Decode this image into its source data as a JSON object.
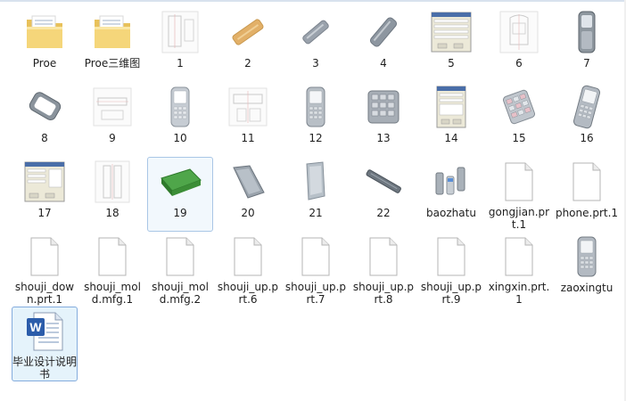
{
  "window": {
    "accent": "#84acdd",
    "selected_bg": "#e5f3fb"
  },
  "items": [
    {
      "label": "Proe",
      "icon": "folder-icon"
    },
    {
      "label": "Proe三维图",
      "icon": "folder-icon"
    },
    {
      "label": "1",
      "icon": "drawing-thumbnail-icon"
    },
    {
      "label": "2",
      "icon": "orange-bar-thumbnail-icon"
    },
    {
      "label": "3",
      "icon": "gray-bar-thumbnail-icon"
    },
    {
      "label": "4",
      "icon": "gray-bar-thumbnail-icon"
    },
    {
      "label": "5",
      "icon": "dialog-thumbnail-icon"
    },
    {
      "label": "6",
      "icon": "drawing-thumbnail-icon"
    },
    {
      "label": "7",
      "icon": "phone-shell-thumbnail-icon"
    },
    {
      "label": "8",
      "icon": "phone-frame-thumbnail-icon"
    },
    {
      "label": "9",
      "icon": "drawing-thumbnail-icon"
    },
    {
      "label": "10",
      "icon": "phone-thumbnail-icon"
    },
    {
      "label": "11",
      "icon": "drawing-thumbnail-icon"
    },
    {
      "label": "12",
      "icon": "phone-thumbnail-icon"
    },
    {
      "label": "13",
      "icon": "keypad-thumbnail-icon"
    },
    {
      "label": "14",
      "icon": "dialog-thumbnail-icon"
    },
    {
      "label": "15",
      "icon": "keypad-color-thumbnail-icon"
    },
    {
      "label": "16",
      "icon": "phone-thumbnail-icon"
    },
    {
      "label": "17",
      "icon": "dialog-thumbnail-icon"
    },
    {
      "label": "18",
      "icon": "drawing-thumbnail-icon"
    },
    {
      "label": "19",
      "icon": "green-mold-thumbnail-icon"
    },
    {
      "label": "20",
      "icon": "gray-plate-thumbnail-icon"
    },
    {
      "label": "21",
      "icon": "gray-plate-thumbnail-icon"
    },
    {
      "label": "22",
      "icon": "gray-bar-thumbnail-icon"
    },
    {
      "label": "baozhatu",
      "icon": "exploded-thumbnail-icon"
    },
    {
      "label": "gongjian.prt.1",
      "icon": "blank-file-icon"
    },
    {
      "label": "phone.prt.1",
      "icon": "blank-file-icon"
    },
    {
      "label": "shouji_down.prt.1",
      "icon": "blank-file-icon"
    },
    {
      "label": "shouji_mold.mfg.1",
      "icon": "blank-file-icon"
    },
    {
      "label": "shouji_mold.mfg.2",
      "icon": "blank-file-icon"
    },
    {
      "label": "shouji_up.prt.6",
      "icon": "blank-file-icon"
    },
    {
      "label": "shouji_up.prt.7",
      "icon": "blank-file-icon"
    },
    {
      "label": "shouji_up.prt.8",
      "icon": "blank-file-icon"
    },
    {
      "label": "shouji_up.prt.9",
      "icon": "blank-file-icon"
    },
    {
      "label": "xingxin.prt.1",
      "icon": "blank-file-icon"
    },
    {
      "label": "zaoxingtu",
      "icon": "phone-thumbnail-icon"
    },
    {
      "label": "毕业设计说明书",
      "icon": "word-document-icon"
    }
  ]
}
